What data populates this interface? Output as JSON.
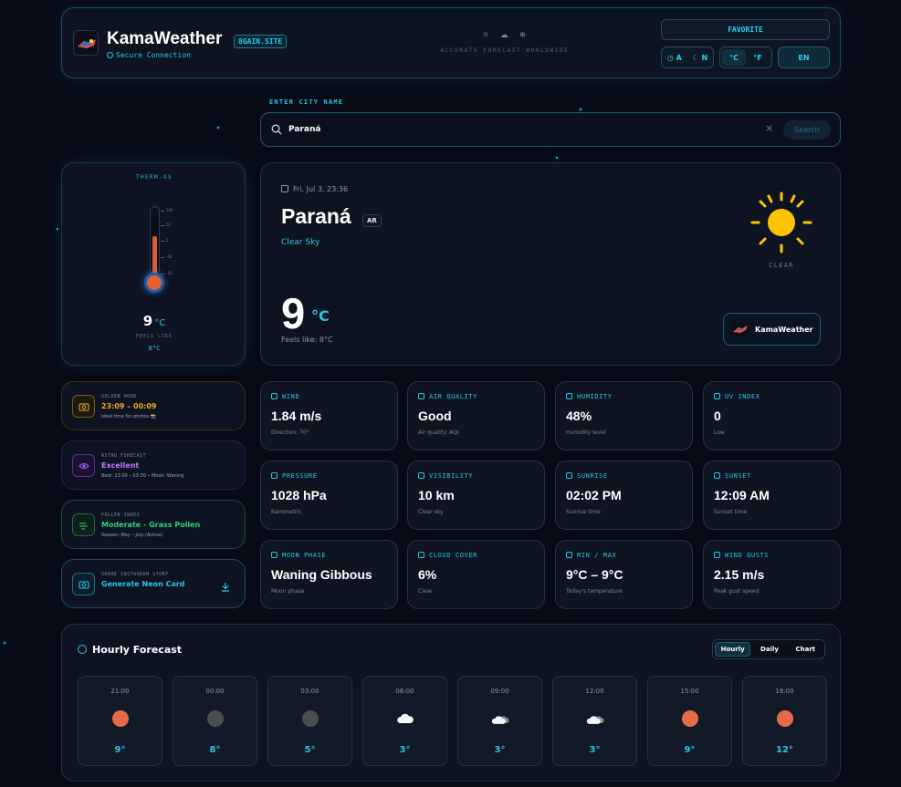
{
  "header": {
    "app_title": "KamaWeather",
    "domain_badge": "8GAIN.SITE",
    "secure_text": "Secure Connection",
    "tagline": "ACCURATE FORECAST WORLDWIDE",
    "favorite_label": "FAVORITE",
    "theme_auto": "A",
    "theme_night": "N",
    "unit_c": "°C",
    "unit_f": "°F",
    "lang": "EN",
    "active_unit": "°C"
  },
  "search": {
    "label": "ENTER CITY NAME",
    "value": "Paraná",
    "clear": "×",
    "button": "Search"
  },
  "thermometer": {
    "title": "THERM-OS",
    "ticks": [
      "100",
      "50",
      "0",
      "-50",
      "-10"
    ],
    "temp": "9",
    "unit": "°C",
    "feels_label": "FEELS LIKE",
    "feels_value": "8°C",
    "level_fraction": 0.55
  },
  "current": {
    "date": "Fri, Jul 3, 23:36",
    "city": "Paraná",
    "country": "AR",
    "condition": "Clear Sky",
    "temp": "9",
    "unit": "°C",
    "feels": "Feels like: 8°C",
    "icon_label": "CLEAR",
    "brand": "KamaWeather"
  },
  "side_cards": [
    {
      "label": "GOLDEN HOUR",
      "value": "23:09 – 00:09",
      "sub": "Ideal time for photos 📸",
      "color": "#f5a524"
    },
    {
      "label": "ASTRO FORECAST",
      "value": "Excellent",
      "sub": "Best: 23:00 – 03:30 • Moon: Waning",
      "color": "#b05cff"
    },
    {
      "label": "POLLEN INDEX",
      "value": "Moderate - Grass Pollen",
      "sub": "Season: May – July (Active)",
      "color": "#31d17c"
    },
    {
      "label": "SHARE INSTAGRAM STORY",
      "value": "Generate Neon Card",
      "sub": "",
      "color": "#29c7e8"
    }
  ],
  "stats": [
    {
      "label": "WIND",
      "value": "1.84 m/s",
      "sub": "Direction: 70°"
    },
    {
      "label": "AIR QUALITY",
      "value": "Good",
      "sub": "Air quality: AQI"
    },
    {
      "label": "HUMIDITY",
      "value": "48%",
      "sub": "Humidity level"
    },
    {
      "label": "UV INDEX",
      "value": "0",
      "sub": "Low"
    },
    {
      "label": "PRESSURE",
      "value": "1028 hPa",
      "sub": "Barometric"
    },
    {
      "label": "VISIBILITY",
      "value": "10 km",
      "sub": "Clear sky"
    },
    {
      "label": "SUNRISE",
      "value": "02:02 PM",
      "sub": "Sunrise time"
    },
    {
      "label": "SUNSET",
      "value": "12:09 AM",
      "sub": "Sunset time"
    },
    {
      "label": "MOON PHASE",
      "value": "Waning Gibbous",
      "sub": "Moon phase"
    },
    {
      "label": "CLOUD COVER",
      "value": "6%",
      "sub": "Clear"
    },
    {
      "label": "MIN / MAX",
      "value": "9°C – 9°C",
      "sub": "Today's temperature"
    },
    {
      "label": "WIND GUSTS",
      "value": "2.15 m/s",
      "sub": "Peak gust speed"
    }
  ],
  "hourly": {
    "title": "Hourly Forecast",
    "tabs": [
      "Hourly",
      "Daily",
      "Chart"
    ],
    "active_tab": "Hourly",
    "items": [
      {
        "time": "21:00",
        "icon": "sun-icon",
        "temp": "9°"
      },
      {
        "time": "00:00",
        "icon": "moon-icon",
        "temp": "8°"
      },
      {
        "time": "03:00",
        "icon": "moon-icon",
        "temp": "5°"
      },
      {
        "time": "06:00",
        "icon": "cloud-icon",
        "temp": "3°"
      },
      {
        "time": "09:00",
        "icon": "partly-cloudy-icon",
        "temp": "3°"
      },
      {
        "time": "12:00",
        "icon": "partly-cloudy-icon",
        "temp": "3°"
      },
      {
        "time": "15:00",
        "icon": "sun-icon",
        "temp": "9°"
      },
      {
        "time": "18:00",
        "icon": "sun-icon",
        "temp": "12°"
      }
    ]
  },
  "colors": {
    "accent": "#29c7e8",
    "sun": "#ffc400",
    "thermo_fill": "#e05a35"
  }
}
